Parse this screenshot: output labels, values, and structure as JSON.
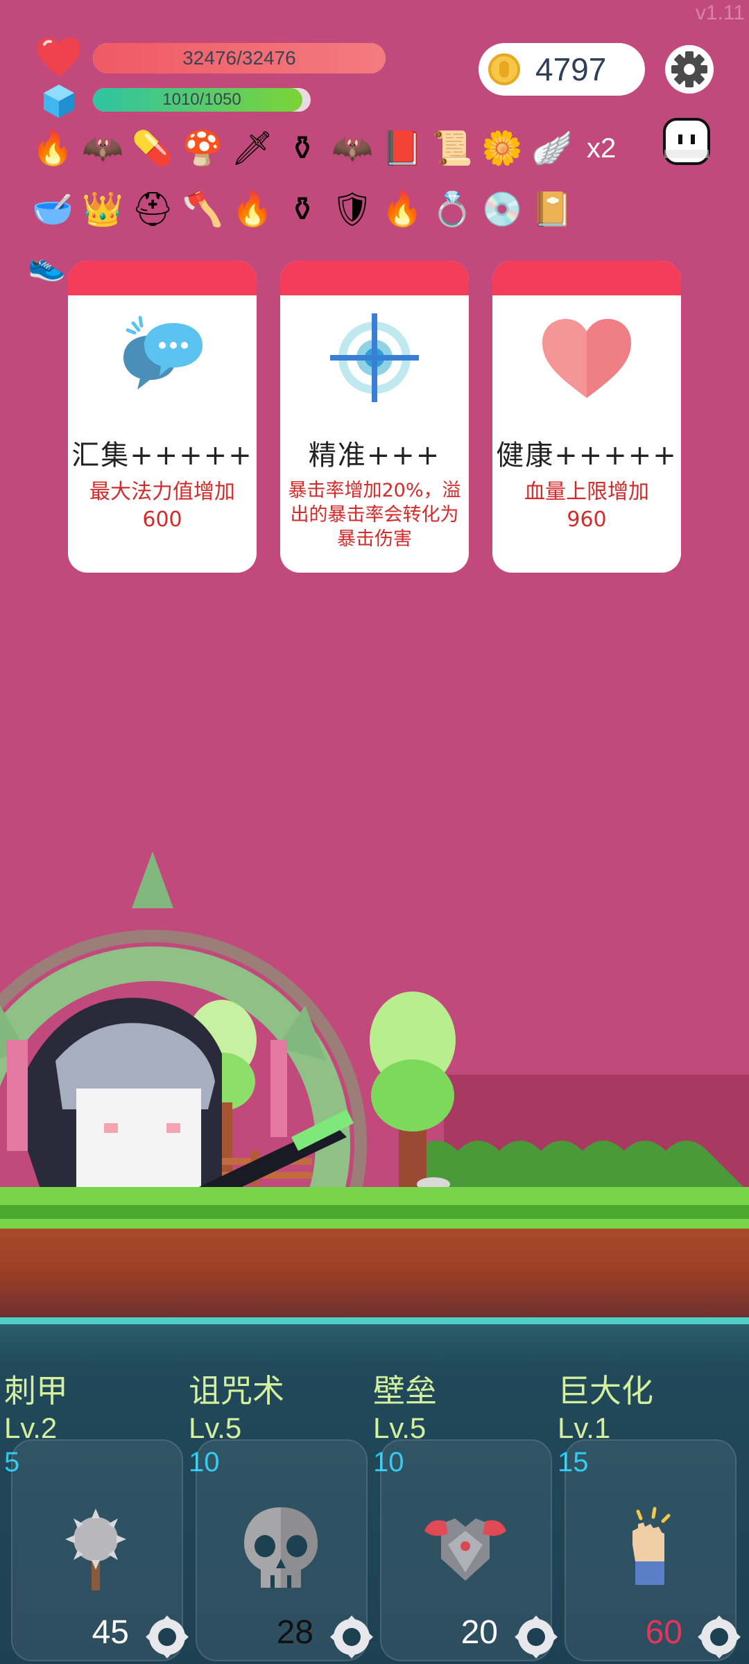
{
  "version": "v1.11",
  "hud": {
    "hp_text": "32476/32476",
    "hp_fraction": 1.0,
    "mp_text": "1010/1050",
    "mp_fraction": 0.962,
    "coins": "4797"
  },
  "inventory": {
    "row1": [
      "fire-brazier-icon",
      "bat-icon",
      "pill-icon",
      "mushroom-icon",
      "sword-icon",
      "cauldron-icon",
      "bat-icon",
      "skull-book-icon",
      "scroll-icon",
      "flower-icon",
      "wing-icon"
    ],
    "multiplier": "x2",
    "row2": [
      "mortar-icon",
      "crown-icon",
      "knight-helmet-icon",
      "axe-icon",
      "fire-brazier-icon",
      "cauldron-icon",
      "armor-icon",
      "fire-brazier-icon",
      "ring-icon",
      "disc-icon",
      "spell-book-icon"
    ]
  },
  "choices": [
    {
      "title": "汇集+++++",
      "desc": "最大法力值增加600",
      "icon": "chat-bubble-icon"
    },
    {
      "title": "精准+++",
      "desc": "暴击率增加20%，溢出的暴击率会转化为暴击伤害",
      "icon": "crosshair-icon"
    },
    {
      "title": "健康+++++",
      "desc": "血量上限增加960",
      "icon": "heart-icon"
    }
  ],
  "skills": [
    {
      "name": "刺甲",
      "level": "Lv.2",
      "cost": "5",
      "price": "45",
      "price_color": "white",
      "icon": "spiked-mace-icon"
    },
    {
      "name": "诅咒术",
      "level": "Lv.5",
      "cost": "10",
      "price": "28",
      "price_color": "black",
      "icon": "skull-icon"
    },
    {
      "name": "壁垒",
      "level": "Lv.5",
      "cost": "10",
      "price": "20",
      "price_color": "white",
      "icon": "armor-icon"
    },
    {
      "name": "巨大化",
      "level": "Lv.1",
      "cost": "15",
      "price": "60",
      "price_color": "red",
      "icon": "fist-icon"
    }
  ],
  "colors": {
    "background": "#c1497b",
    "card_header": "#f53c58",
    "card_desc": "#d42a2a",
    "skill_text": "#d4f09e",
    "skill_cost": "#27c7ef"
  }
}
